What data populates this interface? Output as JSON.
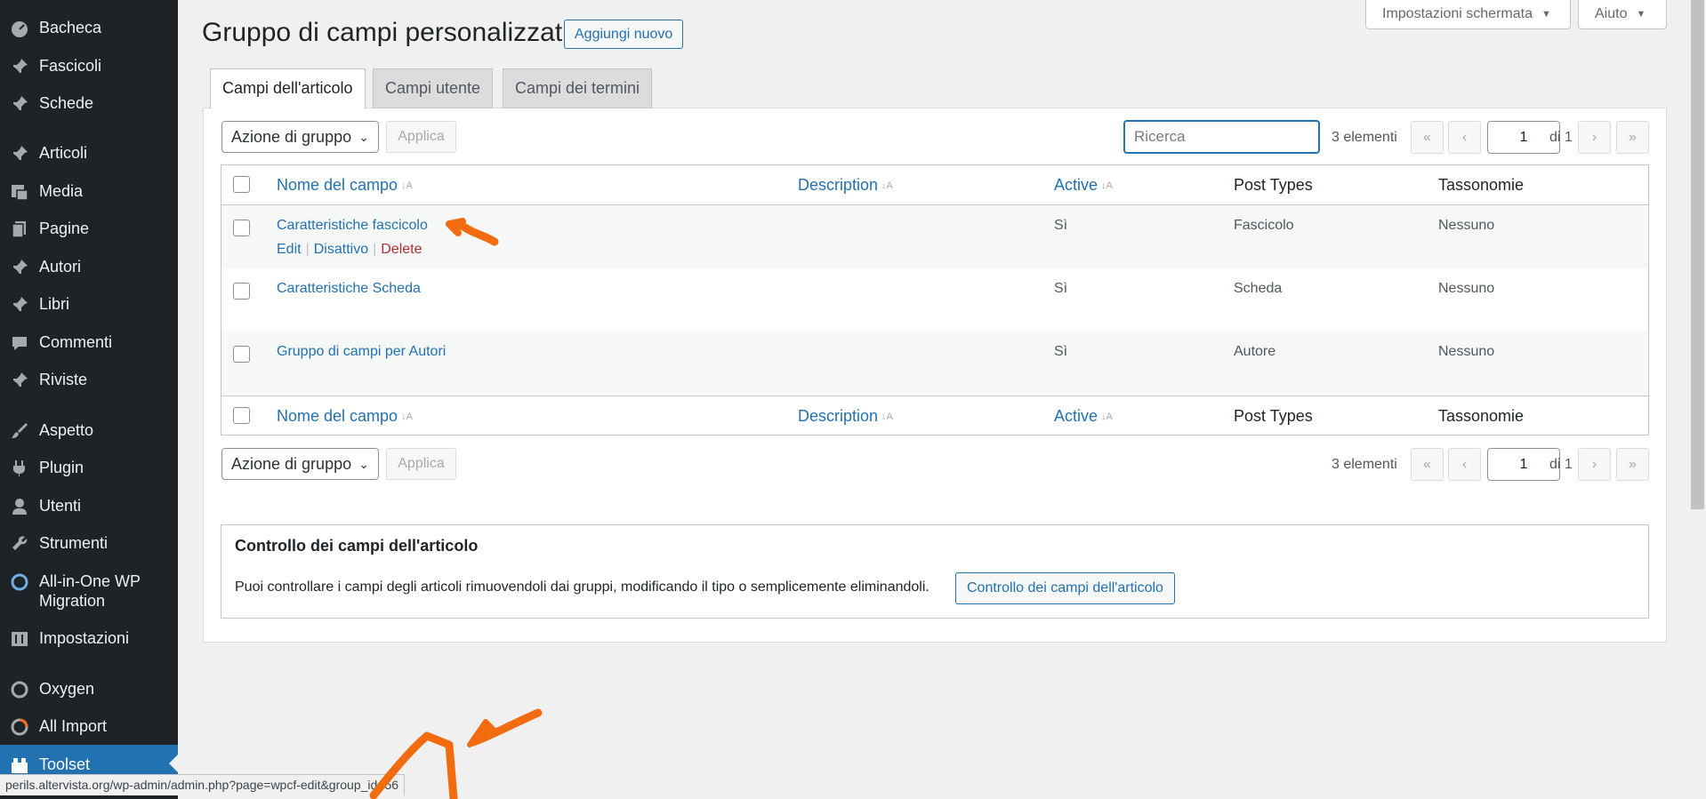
{
  "sidebar": {
    "items": [
      {
        "label": "Bacheca",
        "icon": "dashboard-icon"
      },
      {
        "label": "Fascicoli",
        "icon": "pin-icon"
      },
      {
        "label": "Schede",
        "icon": "pin-icon"
      },
      {
        "label": "Articoli",
        "icon": "pin-icon"
      },
      {
        "label": "Media",
        "icon": "media-icon"
      },
      {
        "label": "Pagine",
        "icon": "page-icon"
      },
      {
        "label": "Autori",
        "icon": "pin-icon"
      },
      {
        "label": "Libri",
        "icon": "pin-icon"
      },
      {
        "label": "Commenti",
        "icon": "comment-icon"
      },
      {
        "label": "Riviste",
        "icon": "pin-icon"
      },
      {
        "label": "Aspetto",
        "icon": "brush-icon"
      },
      {
        "label": "Plugin",
        "icon": "plugin-icon"
      },
      {
        "label": "Utenti",
        "icon": "user-icon"
      },
      {
        "label": "Strumenti",
        "icon": "wrench-icon"
      },
      {
        "label": "All-in-One WP Migration",
        "icon": "migration-icon"
      },
      {
        "label": "Impostazioni",
        "icon": "settings-icon"
      },
      {
        "label": "Oxygen",
        "icon": "oxygen-icon"
      },
      {
        "label": "All Import",
        "icon": "import-icon"
      },
      {
        "label": "Toolset",
        "icon": "toolset-icon"
      }
    ]
  },
  "header": {
    "title": "Gruppo di campi personalizzati",
    "add_new": "Aggiungi nuovo",
    "screen_options": "Impostazioni schermata",
    "help": "Aiuto"
  },
  "tabs": [
    "Campi dell'articolo",
    "Campi utente",
    "Campi dei termini"
  ],
  "toolbar": {
    "bulk_action": "Azione di gruppo",
    "apply": "Applica",
    "search_placeholder": "Ricerca",
    "items_count": "3 elementi",
    "page_current": "1",
    "page_of": "di 1",
    "first": "«",
    "prev": "‹",
    "next": "›",
    "last": "»"
  },
  "table": {
    "columns": [
      "Nome del campo",
      "Description",
      "Active",
      "Post Types",
      "Tassonomie"
    ],
    "rows": [
      {
        "name": "Caratteristiche fascicolo",
        "description": "",
        "active": "Sì",
        "post_types": "Fascicolo",
        "taxonomies": "Nessuno"
      },
      {
        "name": "Caratteristiche Scheda",
        "description": "",
        "active": "Sì",
        "post_types": "Scheda",
        "taxonomies": "Nessuno"
      },
      {
        "name": "Gruppo di campi per Autori",
        "description": "",
        "active": "Sì",
        "post_types": "Autore",
        "taxonomies": "Nessuno"
      }
    ],
    "row_actions": {
      "edit": "Edit",
      "deactivate": "Disattivo",
      "delete": "Delete"
    }
  },
  "control": {
    "title": "Controllo dei campi dell'articolo",
    "description": "Puoi controllare i campi degli articoli rimuovendoli dai gruppi, modificando il tipo o semplicemente eliminandoli.",
    "button": "Controllo dei campi dell'articolo"
  },
  "statusbar": "perils.altervista.org/wp-admin/admin.php?page=wpcf-edit&group_id=56",
  "colors": {
    "accent": "#2271b1",
    "sidebar": "#1d2327",
    "annotation": "#f26b0f",
    "delete": "#b32d2e"
  }
}
